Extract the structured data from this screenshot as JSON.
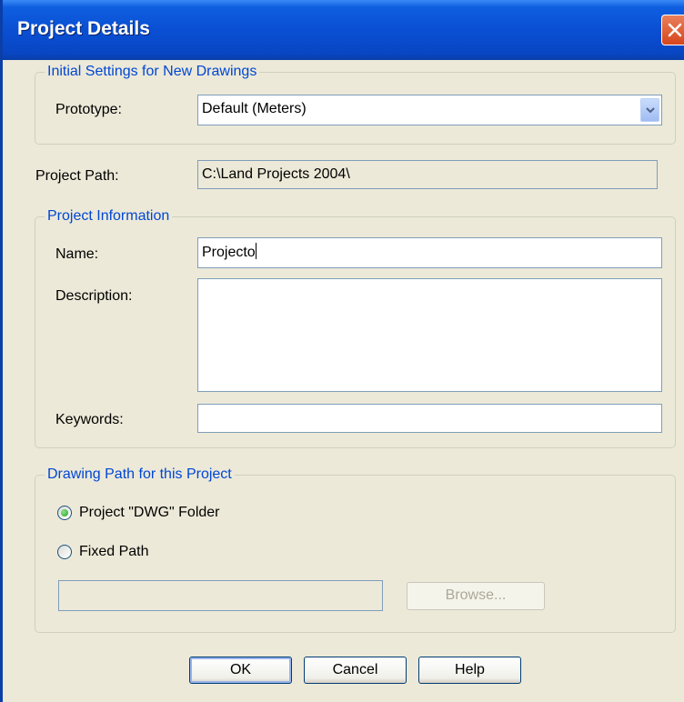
{
  "window": {
    "title": "Project Details"
  },
  "initial_settings": {
    "legend": "Initial Settings for New Drawings",
    "prototype_label": "Prototype:",
    "prototype_value": "Default (Meters)"
  },
  "project_path": {
    "label": "Project Path:",
    "value": "C:\\Land Projects 2004\\"
  },
  "project_info": {
    "legend": "Project Information",
    "name_label": "Name:",
    "name_value": "Projecto",
    "description_label": "Description:",
    "description_value": "",
    "keywords_label": "Keywords:",
    "keywords_value": ""
  },
  "drawing_path": {
    "legend": "Drawing Path for this Project",
    "option_dwg_label": "Project \"DWG\" Folder",
    "option_fixed_label": "Fixed Path",
    "selected_option": "Project \"DWG\" Folder",
    "fixed_path_value": "",
    "browse_label": "Browse..."
  },
  "buttons": {
    "ok": "OK",
    "cancel": "Cancel",
    "help": "Help"
  },
  "icons": {
    "close": "close-icon",
    "dropdown": "chevron-down-icon",
    "radio_selected": "radio-selected-icon",
    "radio_unselected": "radio-unselected-icon"
  }
}
